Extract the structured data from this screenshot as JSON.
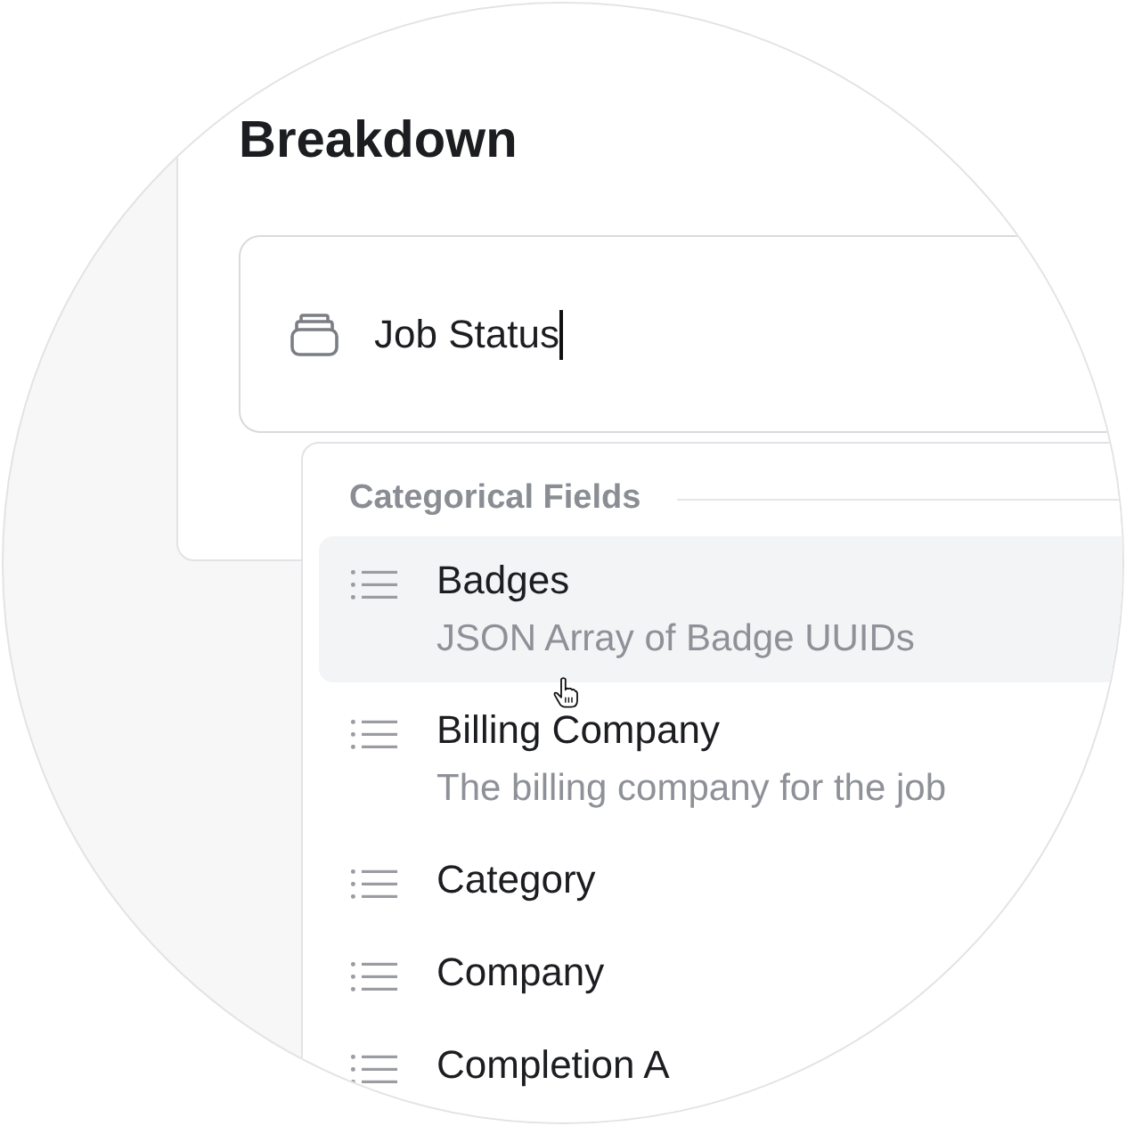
{
  "card": {
    "title": "Breakdown"
  },
  "field": {
    "value": "Job Status"
  },
  "dropdown": {
    "section": "Categorical Fields",
    "items": [
      {
        "label": "Badges",
        "description": "JSON Array of Badge UUIDs",
        "selected": true
      },
      {
        "label": "Billing Company",
        "description": "The billing company for the job",
        "selected": false
      },
      {
        "label": "Category",
        "selected": false
      },
      {
        "label": "Company",
        "selected": false
      },
      {
        "label": "Completion A",
        "selected": false
      }
    ]
  }
}
